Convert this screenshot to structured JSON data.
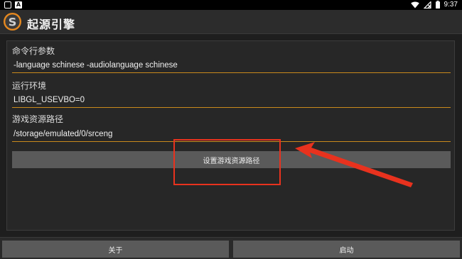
{
  "status_bar": {
    "time": "9:37",
    "icons": [
      "square-icon",
      "a-notification-icon",
      "wifi-icon",
      "cellular-off-icon",
      "battery-icon"
    ]
  },
  "action_bar": {
    "title": "起源引擎",
    "logo_icon": "source-engine-logo-icon"
  },
  "form": {
    "cmd_args": {
      "label": "命令行参数",
      "value": "-language schinese -audiolanguage schinese"
    },
    "env": {
      "label": "运行环境",
      "value": "LIBGL_USEVBO=0"
    },
    "game_path": {
      "label": "游戏资源路径",
      "value": "/storage/emulated/0/srceng"
    },
    "set_path_button": "设置游戏资源路径"
  },
  "bottom_bar": {
    "about_button": "关于",
    "launch_button": "启动"
  },
  "colors": {
    "accent_underline": "#c98a1c",
    "annotation_red": "#e8321e",
    "button_gray": "#5a5a5a"
  }
}
